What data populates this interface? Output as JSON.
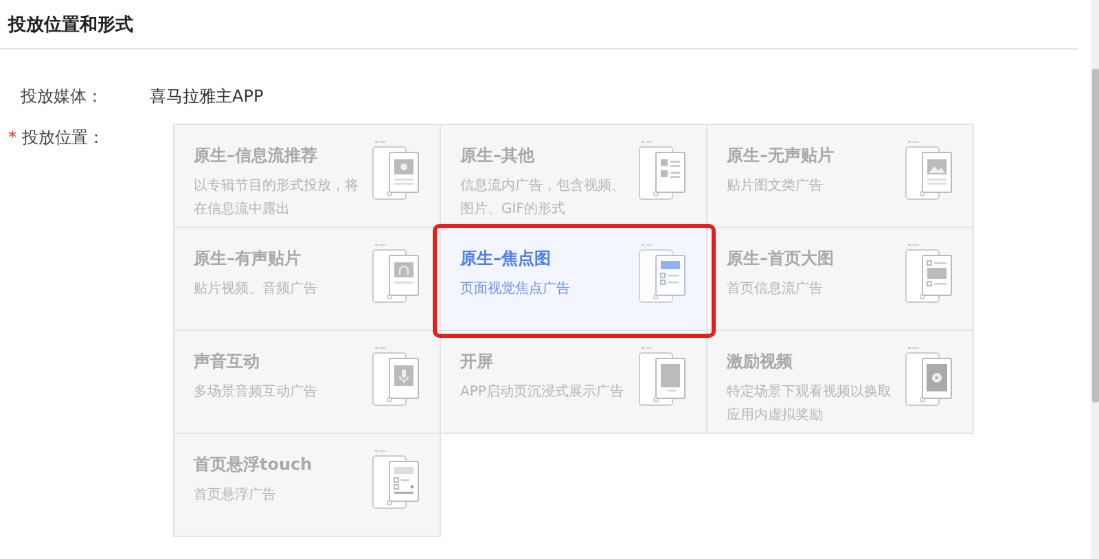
{
  "section": {
    "title": "投放位置和形式"
  },
  "media": {
    "label": "投放媒体：",
    "value": "喜马拉雅主APP"
  },
  "placement": {
    "required_mark": "*",
    "label": "投放位置：",
    "options": [
      {
        "title": "原生–信息流推荐",
        "description": "以专辑节目的形式投放，将在信息流中露出",
        "selected": false
      },
      {
        "title": "原生–其他",
        "description": "信息流内广告，包含视频、图片、GIF的形式",
        "selected": false
      },
      {
        "title": "原生–无声贴片",
        "description": "贴片图文类广告",
        "selected": false
      },
      {
        "title": "原生–有声贴片",
        "description": "贴片视频、音频广告",
        "selected": false
      },
      {
        "title": "原生–焦点图",
        "description": "页面视觉焦点广告",
        "selected": true
      },
      {
        "title": "原生–首页大图",
        "description": "首页信息流广告",
        "selected": false
      },
      {
        "title": "声音互动",
        "description": "多场景音频互动广告",
        "selected": false
      },
      {
        "title": "开屏",
        "description": "APP启动页沉浸式展示广告",
        "selected": false
      },
      {
        "title": "激励视频",
        "description": "特定场景下观看视频以换取应用内虚拟奖励",
        "selected": false
      },
      {
        "title": "首页悬浮touch",
        "description": "首页悬浮广告",
        "selected": false
      }
    ]
  }
}
